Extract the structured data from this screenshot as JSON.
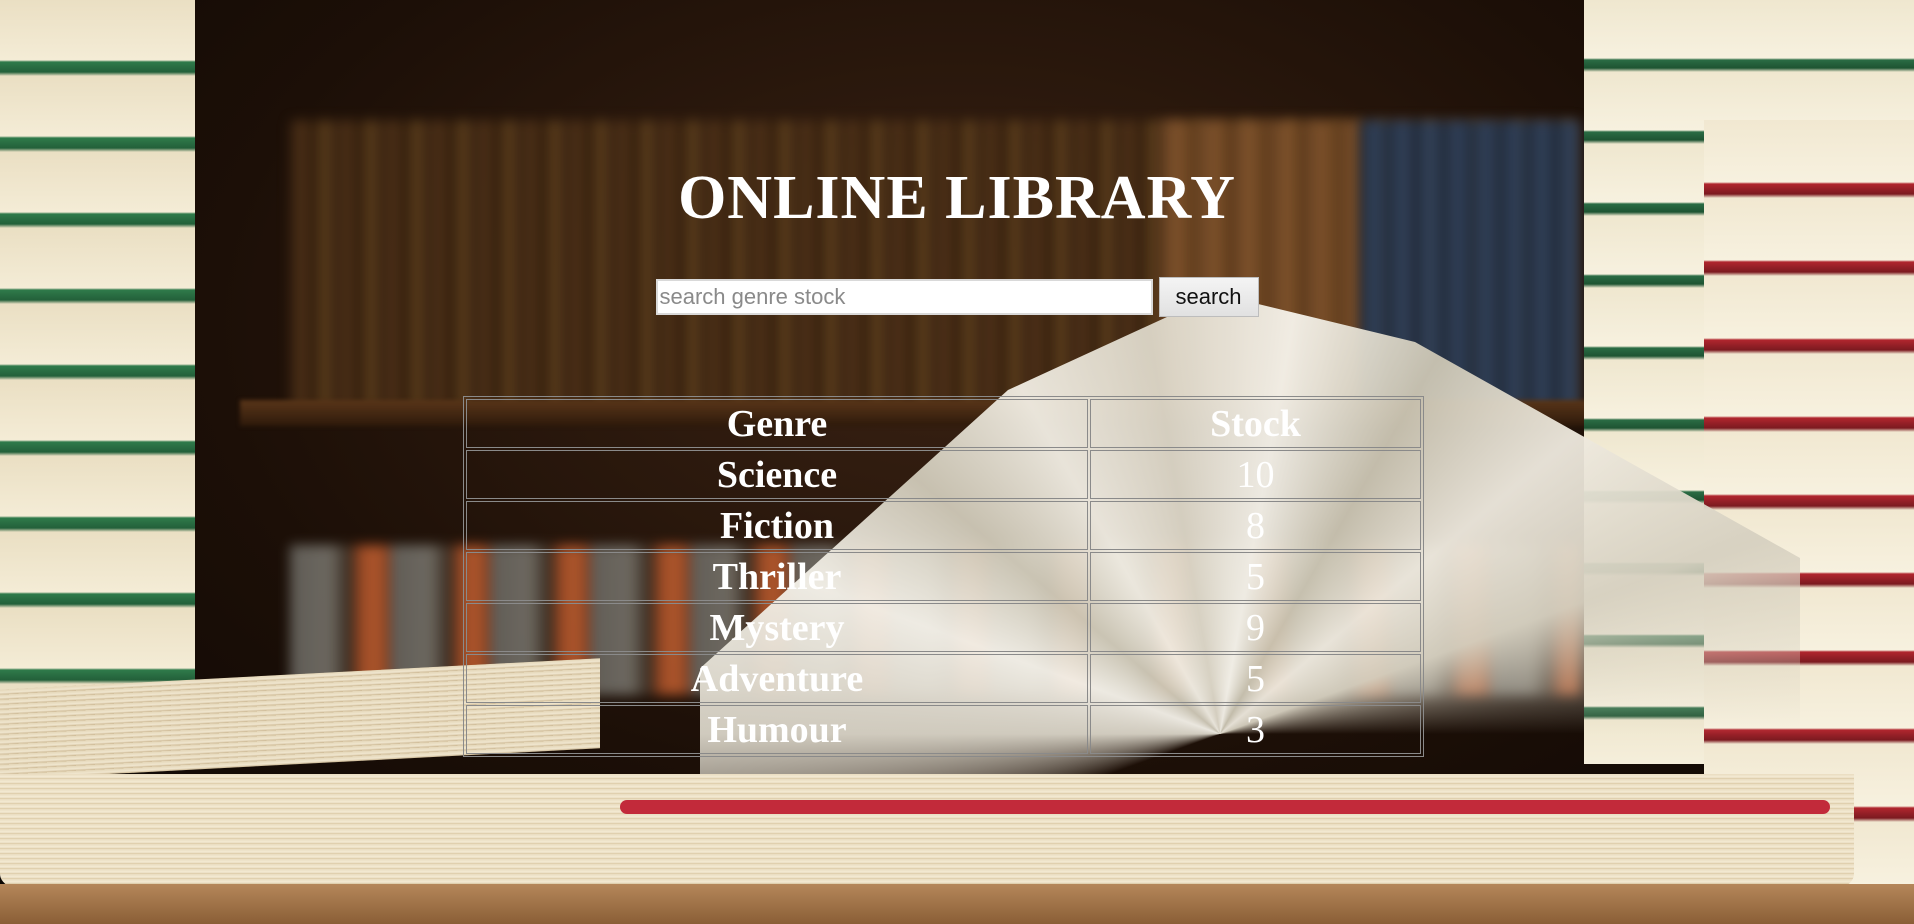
{
  "header": {
    "title": "ONLINE LIBRARY"
  },
  "search": {
    "placeholder": "search genre stock",
    "value": "",
    "button_label": "search"
  },
  "table": {
    "columns": [
      "Genre",
      "Stock"
    ],
    "rows": [
      {
        "genre": "Science",
        "stock": "10"
      },
      {
        "genre": "Fiction",
        "stock": "8"
      },
      {
        "genre": "Thriller",
        "stock": "5"
      },
      {
        "genre": "Mystery",
        "stock": "9"
      },
      {
        "genre": "Adventure",
        "stock": "5"
      },
      {
        "genre": "Humour",
        "stock": "3"
      }
    ]
  },
  "colors": {
    "text": "#ffffff",
    "table_border": "#8a8a8a",
    "input_bg": "#ffffff"
  }
}
